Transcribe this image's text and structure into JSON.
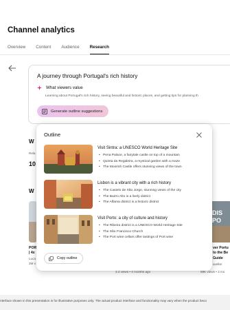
{
  "header": {
    "title": "Channel analytics"
  },
  "tabs": [
    {
      "label": "Overview",
      "active": false
    },
    {
      "label": "Content",
      "active": false
    },
    {
      "label": "Audience",
      "active": false
    },
    {
      "label": "Research",
      "active": true
    }
  ],
  "card": {
    "title": "A journey through Portugal's rich history",
    "section_label": "What viewers value",
    "description": "Learning about Portugal's rich history, seeing beautiful and historic places, and getting tips for planning th",
    "generate_button": "Generate outline suggestions"
  },
  "background": {
    "heading_w1": "W",
    "rel": "Rela",
    "num": "10",
    "heading_w2": "W",
    "left_caption_1": "POR",
    "left_caption_2": "| 4x",
    "left_caption_3": "Luca",
    "left_caption_4": "2M v",
    "mid_meta": "3.4 views • 4 months ago",
    "right_caption_1": "ver Portu",
    "right_caption_2": "to the Be",
    "right_caption_3": "Guide",
    "right_caption_4": "aveller",
    "right_meta": "59K views • 3 mo"
  },
  "outline": {
    "title": "Outline",
    "items": [
      {
        "heading": "Visit Sintra: a UNESCO World Heritage Site",
        "bullets": [
          "Pena Palace, a fairytale castle on top of a mountain",
          "Quinta da Regaleira, a mystical garden with a maze",
          "The Moorish Castle offers stunning views of the town"
        ]
      },
      {
        "heading": "Lisbon is a vibrant city with a rich history",
        "bullets": [
          "The Castelo de São Jorge, stunning views of the city",
          "The Bairro Alto is a lively district",
          "The Alfama district is a historic district"
        ]
      },
      {
        "heading": "Visit Porto: a city of culture and history",
        "bullets": [
          "The Ribeira district is a UNESCO World Heritage Site",
          "The São Francisco Church",
          "The Port wine cellars offer tastings of Port wine"
        ]
      }
    ],
    "copy_button": "Copy outline"
  },
  "disclaimer": "nterface shown in this presentation is for illustrative purposes only. The actual product interface and functionality may vary when the product beco",
  "colors": {
    "accent_sparkle": "#e2187a",
    "generate_gradient_start": "#eac3ee",
    "generate_gradient_end": "#f1c6d8"
  },
  "icons": [
    "back-arrow-icon",
    "sparkle-icon",
    "outline-generate-icon",
    "close-icon",
    "copy-icon"
  ]
}
